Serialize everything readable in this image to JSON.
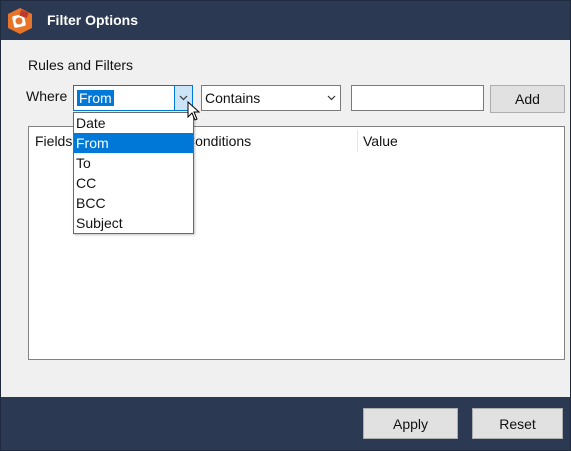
{
  "window": {
    "title": "Filter Options",
    "icon": "app-logo-icon"
  },
  "section": {
    "label": "Rules and Filters"
  },
  "where": {
    "label": "Where",
    "field_value": "From",
    "condition_value": "Contains",
    "value_input": "",
    "add_label": "Add"
  },
  "dropdown": {
    "options": [
      "Date",
      "From",
      "To",
      "CC",
      "BCC",
      "Subject"
    ],
    "selected": "From"
  },
  "grid": {
    "columns": [
      "Fields",
      "Conditions",
      "Value"
    ],
    "rows": []
  },
  "footer": {
    "apply_label": "Apply",
    "reset_label": "Reset"
  },
  "colors": {
    "titlebar": "#2b3a52",
    "accent": "#0078d7",
    "icon_orange": "#e8742a"
  }
}
